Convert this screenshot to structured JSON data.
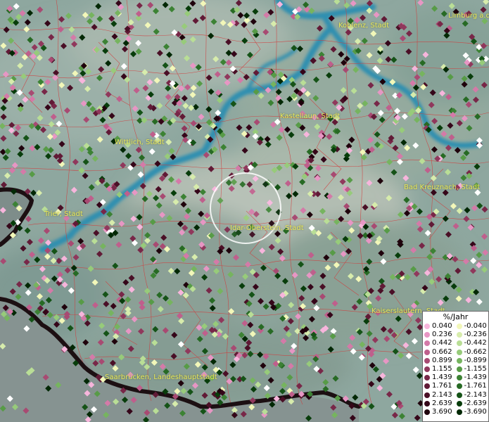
{
  "cities": [
    {
      "name": "Koblenz, Stadt"
    },
    {
      "name": "Limburg a.d."
    },
    {
      "name": "Kastellaun, Stadt"
    },
    {
      "name": "Wittlich, Stadt"
    },
    {
      "name": "Bad Kreuznach, Stadt"
    },
    {
      "name": "Trier, Stadt"
    },
    {
      "name": "Idar-Oberstein, Stadt"
    },
    {
      "name": "Kaiserslautern, Stadt"
    },
    {
      "name": "Saarbrücken, Landeshauptstadt"
    }
  ],
  "legend": {
    "title": "%/Jahr",
    "positive": [
      {
        "label": "0.040",
        "color": "#f7b5dc"
      },
      {
        "label": "0.236",
        "color": "#e796c4"
      },
      {
        "label": "0.442",
        "color": "#d47aa8"
      },
      {
        "label": "0.662",
        "color": "#bf5f8c"
      },
      {
        "label": "0.899",
        "color": "#a84a72"
      },
      {
        "label": "1.155",
        "color": "#90385c"
      },
      {
        "label": "1.439",
        "color": "#782748"
      },
      {
        "label": "1.761",
        "color": "#611a36"
      },
      {
        "label": "2.143",
        "color": "#4a0f26"
      },
      {
        "label": "2.639",
        "color": "#350619"
      },
      {
        "label": "3.690",
        "color": "#1f020c"
      }
    ],
    "negative": [
      {
        "label": "-0.040",
        "color": "#f2f7b9"
      },
      {
        "label": "-0.236",
        "color": "#d7ecac"
      },
      {
        "label": "-0.442",
        "color": "#b9de96"
      },
      {
        "label": "-0.662",
        "color": "#97cb7a"
      },
      {
        "label": "-0.899",
        "color": "#76b45f"
      },
      {
        "label": "-1.155",
        "color": "#579b47"
      },
      {
        "label": "-1.439",
        "color": "#3c8234"
      },
      {
        "label": "-1.761",
        "color": "#276a24"
      },
      {
        "label": "-2.143",
        "color": "#155317"
      },
      {
        "label": "-2.639",
        "color": "#083d0b"
      },
      {
        "label": "-3.690",
        "color": "#022805"
      }
    ]
  },
  "colors": {
    "river": "#2e8fb0",
    "border_lines": "#d23a3a",
    "state_border": "#1c0f12",
    "terrain": "#8aa39c"
  }
}
